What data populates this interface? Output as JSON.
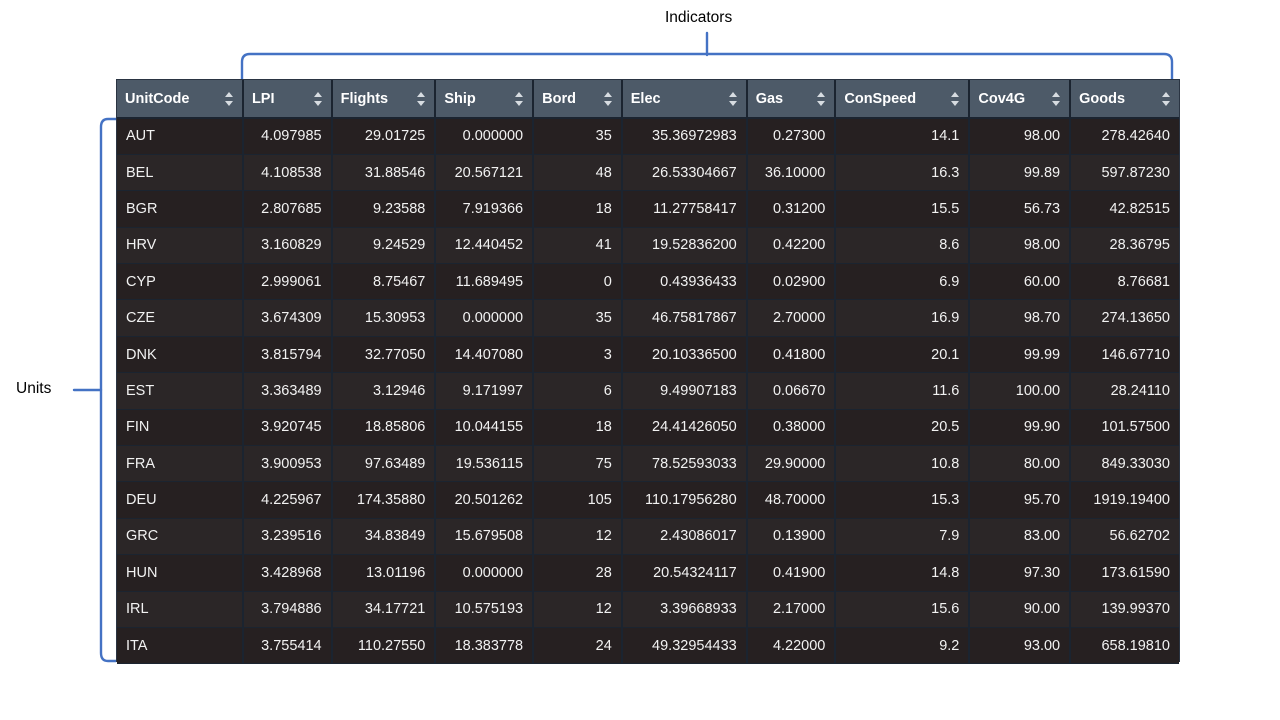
{
  "annotations": {
    "indicators_label": "Indicators",
    "units_label": "Units",
    "bracket_color": "#4472c4"
  },
  "table": {
    "header_bg": "#4d5a68",
    "row_bg": "#262021",
    "row_bg_alt": "#2b2627",
    "text_color": "#f2f2f2",
    "sort_icon": "sort-updown-icon",
    "columns": [
      {
        "key": "UnitCode",
        "label": "UnitCode",
        "align": "left"
      },
      {
        "key": "LPI",
        "label": "LPI",
        "align": "right"
      },
      {
        "key": "Flights",
        "label": "Flights",
        "align": "right"
      },
      {
        "key": "Ship",
        "label": "Ship",
        "align": "right"
      },
      {
        "key": "Bord",
        "label": "Bord",
        "align": "right"
      },
      {
        "key": "Elec",
        "label": "Elec",
        "align": "right"
      },
      {
        "key": "Gas",
        "label": "Gas",
        "align": "right"
      },
      {
        "key": "ConSpeed",
        "label": "ConSpeed",
        "align": "right"
      },
      {
        "key": "Cov4G",
        "label": "Cov4G",
        "align": "right"
      },
      {
        "key": "Goods",
        "label": "Goods",
        "align": "right"
      }
    ],
    "rows": [
      [
        "AUT",
        "4.097985",
        "29.01725",
        "0.000000",
        "35",
        "35.36972983",
        "0.27300",
        "14.1",
        "98.00",
        "278.42640"
      ],
      [
        "BEL",
        "4.108538",
        "31.88546",
        "20.567121",
        "48",
        "26.53304667",
        "36.10000",
        "16.3",
        "99.89",
        "597.87230"
      ],
      [
        "BGR",
        "2.807685",
        "9.23588",
        "7.919366",
        "18",
        "11.27758417",
        "0.31200",
        "15.5",
        "56.73",
        "42.82515"
      ],
      [
        "HRV",
        "3.160829",
        "9.24529",
        "12.440452",
        "41",
        "19.52836200",
        "0.42200",
        "8.6",
        "98.00",
        "28.36795"
      ],
      [
        "CYP",
        "2.999061",
        "8.75467",
        "11.689495",
        "0",
        "0.43936433",
        "0.02900",
        "6.9",
        "60.00",
        "8.76681"
      ],
      [
        "CZE",
        "3.674309",
        "15.30953",
        "0.000000",
        "35",
        "46.75817867",
        "2.70000",
        "16.9",
        "98.70",
        "274.13650"
      ],
      [
        "DNK",
        "3.815794",
        "32.77050",
        "14.407080",
        "3",
        "20.10336500",
        "0.41800",
        "20.1",
        "99.99",
        "146.67710"
      ],
      [
        "EST",
        "3.363489",
        "3.12946",
        "9.171997",
        "6",
        "9.49907183",
        "0.06670",
        "11.6",
        "100.00",
        "28.24110"
      ],
      [
        "FIN",
        "3.920745",
        "18.85806",
        "10.044155",
        "18",
        "24.41426050",
        "0.38000",
        "20.5",
        "99.90",
        "101.57500"
      ],
      [
        "FRA",
        "3.900953",
        "97.63489",
        "19.536115",
        "75",
        "78.52593033",
        "29.90000",
        "10.8",
        "80.00",
        "849.33030"
      ],
      [
        "DEU",
        "4.225967",
        "174.35880",
        "20.501262",
        "105",
        "110.17956280",
        "48.70000",
        "15.3",
        "95.70",
        "1919.19400"
      ],
      [
        "GRC",
        "3.239516",
        "34.83849",
        "15.679508",
        "12",
        "2.43086017",
        "0.13900",
        "7.9",
        "83.00",
        "56.62702"
      ],
      [
        "HUN",
        "3.428968",
        "13.01196",
        "0.000000",
        "28",
        "20.54324117",
        "0.41900",
        "14.8",
        "97.30",
        "173.61590"
      ],
      [
        "IRL",
        "3.794886",
        "34.17721",
        "10.575193",
        "12",
        "3.39668933",
        "2.17000",
        "15.6",
        "90.00",
        "139.99370"
      ],
      [
        "ITA",
        "3.755414",
        "110.27550",
        "18.383778",
        "24",
        "49.32954433",
        "4.22000",
        "9.2",
        "93.00",
        "658.19810"
      ]
    ]
  }
}
